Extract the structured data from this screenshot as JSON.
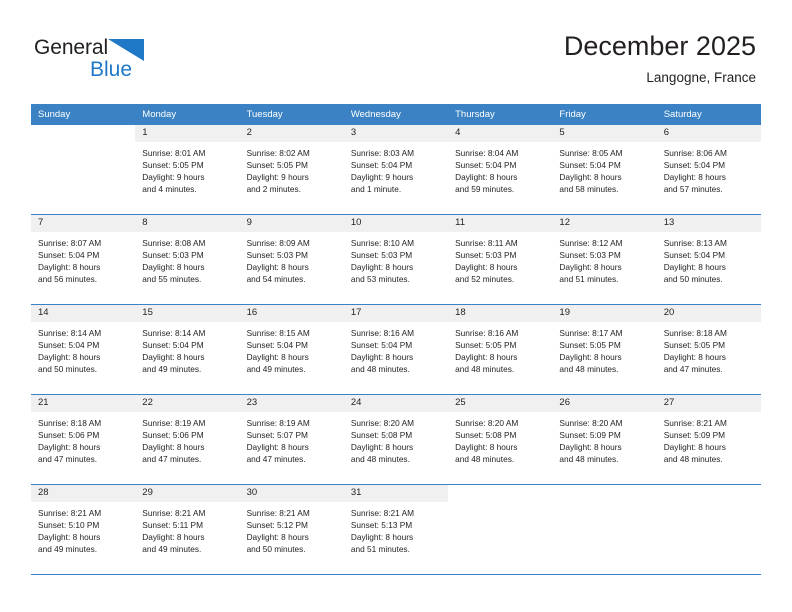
{
  "brand": {
    "name_part1": "General",
    "name_part2": "Blue",
    "triangle_color": "#2079c7"
  },
  "header": {
    "title": "December 2025",
    "subtitle": "Langogne, France"
  },
  "calendar": {
    "header_bg": "#3b82c4",
    "daynum_bg": "#f0f0f0",
    "weekday_labels": [
      "Sunday",
      "Monday",
      "Tuesday",
      "Wednesday",
      "Thursday",
      "Friday",
      "Saturday"
    ],
    "weeks": [
      [
        {
          "day": "",
          "lines": [],
          "blank": true
        },
        {
          "day": "1",
          "lines": [
            "Sunrise: 8:01 AM",
            "Sunset: 5:05 PM",
            "Daylight: 9 hours",
            "and 4 minutes."
          ]
        },
        {
          "day": "2",
          "lines": [
            "Sunrise: 8:02 AM",
            "Sunset: 5:05 PM",
            "Daylight: 9 hours",
            "and 2 minutes."
          ]
        },
        {
          "day": "3",
          "lines": [
            "Sunrise: 8:03 AM",
            "Sunset: 5:04 PM",
            "Daylight: 9 hours",
            "and 1 minute."
          ]
        },
        {
          "day": "4",
          "lines": [
            "Sunrise: 8:04 AM",
            "Sunset: 5:04 PM",
            "Daylight: 8 hours",
            "and 59 minutes."
          ]
        },
        {
          "day": "5",
          "lines": [
            "Sunrise: 8:05 AM",
            "Sunset: 5:04 PM",
            "Daylight: 8 hours",
            "and 58 minutes."
          ]
        },
        {
          "day": "6",
          "lines": [
            "Sunrise: 8:06 AM",
            "Sunset: 5:04 PM",
            "Daylight: 8 hours",
            "and 57 minutes."
          ]
        }
      ],
      [
        {
          "day": "7",
          "lines": [
            "Sunrise: 8:07 AM",
            "Sunset: 5:04 PM",
            "Daylight: 8 hours",
            "and 56 minutes."
          ]
        },
        {
          "day": "8",
          "lines": [
            "Sunrise: 8:08 AM",
            "Sunset: 5:03 PM",
            "Daylight: 8 hours",
            "and 55 minutes."
          ]
        },
        {
          "day": "9",
          "lines": [
            "Sunrise: 8:09 AM",
            "Sunset: 5:03 PM",
            "Daylight: 8 hours",
            "and 54 minutes."
          ]
        },
        {
          "day": "10",
          "lines": [
            "Sunrise: 8:10 AM",
            "Sunset: 5:03 PM",
            "Daylight: 8 hours",
            "and 53 minutes."
          ]
        },
        {
          "day": "11",
          "lines": [
            "Sunrise: 8:11 AM",
            "Sunset: 5:03 PM",
            "Daylight: 8 hours",
            "and 52 minutes."
          ]
        },
        {
          "day": "12",
          "lines": [
            "Sunrise: 8:12 AM",
            "Sunset: 5:03 PM",
            "Daylight: 8 hours",
            "and 51 minutes."
          ]
        },
        {
          "day": "13",
          "lines": [
            "Sunrise: 8:13 AM",
            "Sunset: 5:04 PM",
            "Daylight: 8 hours",
            "and 50 minutes."
          ]
        }
      ],
      [
        {
          "day": "14",
          "lines": [
            "Sunrise: 8:14 AM",
            "Sunset: 5:04 PM",
            "Daylight: 8 hours",
            "and 50 minutes."
          ]
        },
        {
          "day": "15",
          "lines": [
            "Sunrise: 8:14 AM",
            "Sunset: 5:04 PM",
            "Daylight: 8 hours",
            "and 49 minutes."
          ]
        },
        {
          "day": "16",
          "lines": [
            "Sunrise: 8:15 AM",
            "Sunset: 5:04 PM",
            "Daylight: 8 hours",
            "and 49 minutes."
          ]
        },
        {
          "day": "17",
          "lines": [
            "Sunrise: 8:16 AM",
            "Sunset: 5:04 PM",
            "Daylight: 8 hours",
            "and 48 minutes."
          ]
        },
        {
          "day": "18",
          "lines": [
            "Sunrise: 8:16 AM",
            "Sunset: 5:05 PM",
            "Daylight: 8 hours",
            "and 48 minutes."
          ]
        },
        {
          "day": "19",
          "lines": [
            "Sunrise: 8:17 AM",
            "Sunset: 5:05 PM",
            "Daylight: 8 hours",
            "and 48 minutes."
          ]
        },
        {
          "day": "20",
          "lines": [
            "Sunrise: 8:18 AM",
            "Sunset: 5:05 PM",
            "Daylight: 8 hours",
            "and 47 minutes."
          ]
        }
      ],
      [
        {
          "day": "21",
          "lines": [
            "Sunrise: 8:18 AM",
            "Sunset: 5:06 PM",
            "Daylight: 8 hours",
            "and 47 minutes."
          ]
        },
        {
          "day": "22",
          "lines": [
            "Sunrise: 8:19 AM",
            "Sunset: 5:06 PM",
            "Daylight: 8 hours",
            "and 47 minutes."
          ]
        },
        {
          "day": "23",
          "lines": [
            "Sunrise: 8:19 AM",
            "Sunset: 5:07 PM",
            "Daylight: 8 hours",
            "and 47 minutes."
          ]
        },
        {
          "day": "24",
          "lines": [
            "Sunrise: 8:20 AM",
            "Sunset: 5:08 PM",
            "Daylight: 8 hours",
            "and 48 minutes."
          ]
        },
        {
          "day": "25",
          "lines": [
            "Sunrise: 8:20 AM",
            "Sunset: 5:08 PM",
            "Daylight: 8 hours",
            "and 48 minutes."
          ]
        },
        {
          "day": "26",
          "lines": [
            "Sunrise: 8:20 AM",
            "Sunset: 5:09 PM",
            "Daylight: 8 hours",
            "and 48 minutes."
          ]
        },
        {
          "day": "27",
          "lines": [
            "Sunrise: 8:21 AM",
            "Sunset: 5:09 PM",
            "Daylight: 8 hours",
            "and 48 minutes."
          ]
        }
      ],
      [
        {
          "day": "28",
          "lines": [
            "Sunrise: 8:21 AM",
            "Sunset: 5:10 PM",
            "Daylight: 8 hours",
            "and 49 minutes."
          ]
        },
        {
          "day": "29",
          "lines": [
            "Sunrise: 8:21 AM",
            "Sunset: 5:11 PM",
            "Daylight: 8 hours",
            "and 49 minutes."
          ]
        },
        {
          "day": "30",
          "lines": [
            "Sunrise: 8:21 AM",
            "Sunset: 5:12 PM",
            "Daylight: 8 hours",
            "and 50 minutes."
          ]
        },
        {
          "day": "31",
          "lines": [
            "Sunrise: 8:21 AM",
            "Sunset: 5:13 PM",
            "Daylight: 8 hours",
            "and 51 minutes."
          ]
        },
        {
          "day": "",
          "lines": [],
          "blank": true
        },
        {
          "day": "",
          "lines": [],
          "blank": true
        },
        {
          "day": "",
          "lines": [],
          "blank": true
        }
      ]
    ]
  }
}
